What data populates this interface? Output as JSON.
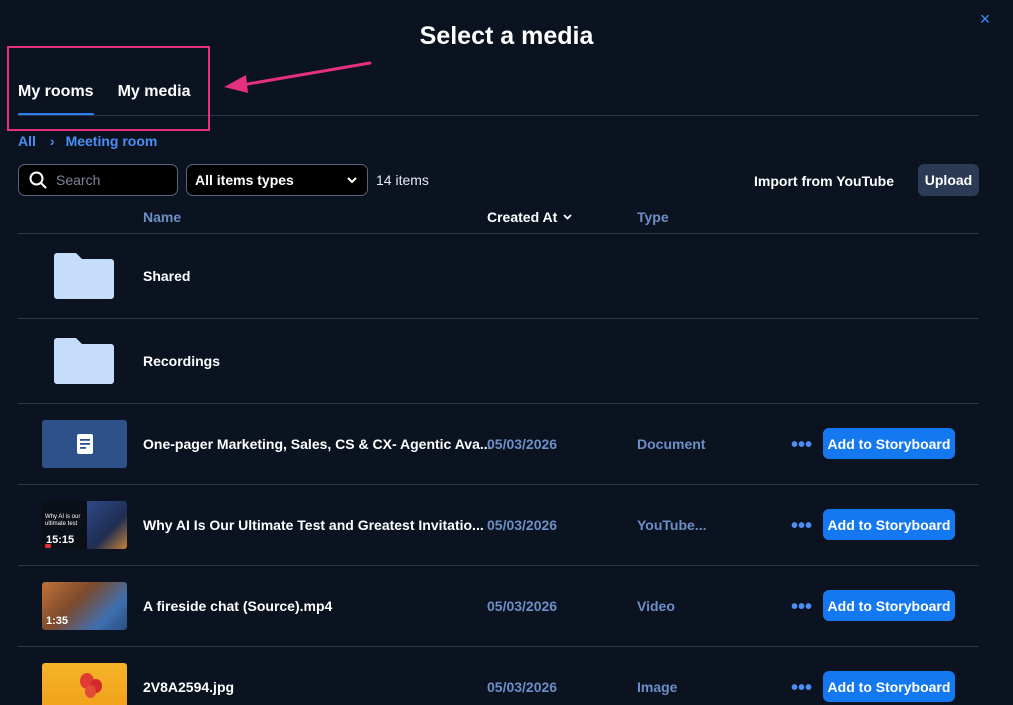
{
  "dialog": {
    "title": "Select a media",
    "close_icon": "×"
  },
  "tabs": [
    {
      "label": "My rooms",
      "active": true
    },
    {
      "label": "My media",
      "active": false
    }
  ],
  "breadcrumb": {
    "root": "All",
    "separator": "›",
    "current": "Meeting room"
  },
  "toolbar": {
    "search_placeholder": "Search",
    "filter_selected": "All items types",
    "item_count": "14 items",
    "import_label": "Import from YouTube",
    "upload_label": "Upload"
  },
  "table": {
    "columns": {
      "name": "Name",
      "created_at": "Created At",
      "type": "Type"
    },
    "rows": [
      {
        "kind": "folder",
        "name": "Shared",
        "icon": "folder-icon"
      },
      {
        "kind": "folder",
        "name": "Recordings",
        "icon": "folder-icon"
      },
      {
        "kind": "file",
        "name": "One-pager Marketing, Sales, CS & CX- Agentic Ava...",
        "date": "05/03/2026",
        "type": "Document",
        "thumb": "document-icon",
        "action": "Add to Storyboard",
        "more": "•••"
      },
      {
        "kind": "file",
        "name": "Why AI Is Our Ultimate Test and Greatest Invitatio...",
        "date": "05/03/2026",
        "type": "YouTube...",
        "thumb_text": "Why AI is our ultimate test",
        "duration": "15:15",
        "action": "Add to Storyboard",
        "more": "•••"
      },
      {
        "kind": "file",
        "name": "A fireside chat (Source).mp4",
        "date": "05/03/2026",
        "type": "Video",
        "duration": "1:35",
        "action": "Add to Storyboard",
        "more": "•••"
      },
      {
        "kind": "file",
        "name": "2V8A2594.jpg",
        "date": "05/03/2026",
        "type": "Image",
        "action": "Add to Storyboard",
        "more": "•••"
      }
    ]
  },
  "colors": {
    "background": "#0b1220",
    "accent": "#1478f0",
    "link": "#4b8ff5",
    "annotation": "#e4307f"
  }
}
